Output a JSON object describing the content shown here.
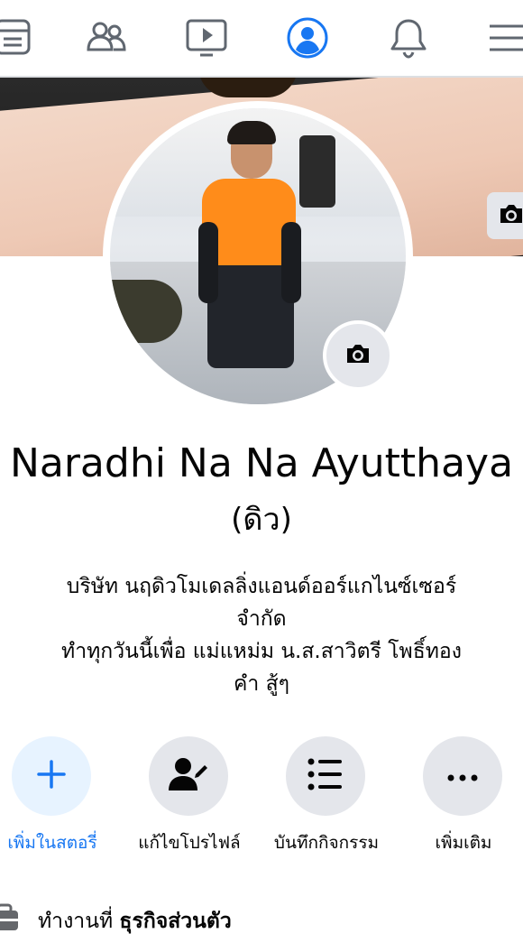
{
  "nav": {
    "items": [
      {
        "name": "feed",
        "icon": "news-feed-icon"
      },
      {
        "name": "friends",
        "icon": "friends-icon"
      },
      {
        "name": "watch",
        "icon": "watch-video-icon"
      },
      {
        "name": "profile",
        "icon": "profile-icon",
        "active": true
      },
      {
        "name": "notifications",
        "icon": "bell-icon"
      },
      {
        "name": "menu",
        "icon": "hamburger-menu-icon"
      }
    ],
    "accent": "#1877f2"
  },
  "profile": {
    "name": "Naradhi Na Na Ayutthaya",
    "nickname": "(ดิว)",
    "bio_lines": [
      "บริษัท นฤดิวโมเดลลิ่งแอนด์ออร์แกไนซ์เซอร์",
      "จำกัด",
      "ทำทุกวันนี้เพื่อ แม่แหม่ม น.ส.สาวิตรี โพธิ์ทอง",
      "คำ สู้ๆ"
    ]
  },
  "actions": [
    {
      "label": "เพิ่มในสตอรี่",
      "icon": "plus-icon",
      "primary": true
    },
    {
      "label": "แก้ไขโปรไฟล์",
      "icon": "edit-profile-icon",
      "primary": false
    },
    {
      "label": "บันทึกกิจกรรม",
      "icon": "activity-log-icon",
      "primary": false
    },
    {
      "label": "เพิ่มเติม",
      "icon": "more-icon",
      "primary": false
    }
  ],
  "work": {
    "prefix": "ทำงานที่",
    "place": "ธุรกิจส่วนตัว"
  }
}
